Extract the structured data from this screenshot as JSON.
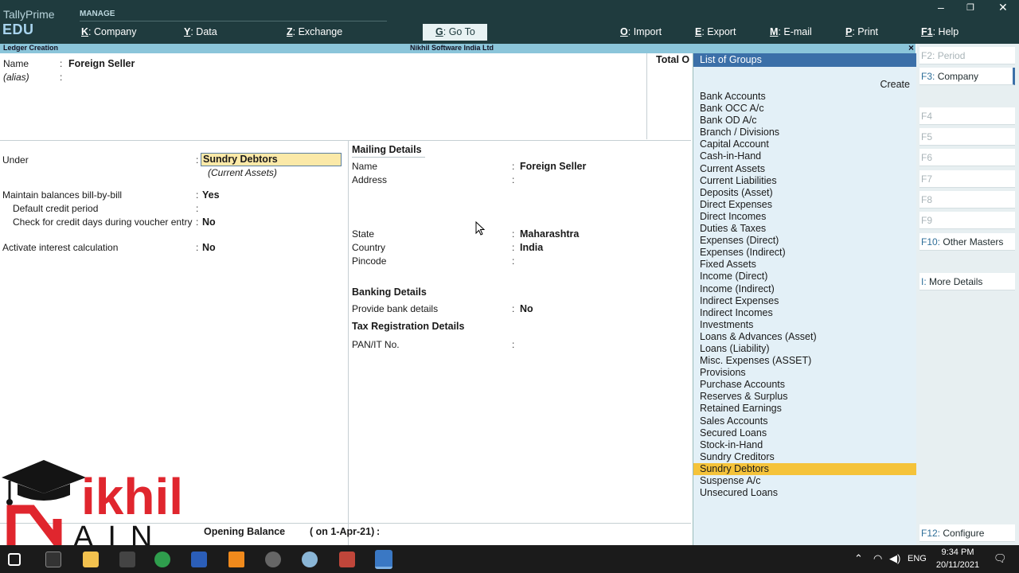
{
  "topbar": {
    "brand": "TallyPrime",
    "edition": "EDU",
    "manage_label": "MANAGE",
    "menu": [
      {
        "key": "K",
        "label": "Company"
      },
      {
        "key": "Y",
        "label": "Data"
      },
      {
        "key": "Z",
        "label": "Exchange"
      },
      {
        "key": "G",
        "label": "Go To"
      },
      {
        "key": "O",
        "label": "Import"
      },
      {
        "key": "E",
        "label": "Export"
      },
      {
        "key": "M",
        "label": "E-mail"
      },
      {
        "key": "P",
        "label": "Print"
      },
      {
        "key": "F1",
        "label": "Help"
      }
    ],
    "window_controls": {
      "minimize": "–",
      "restore": "❐",
      "close": "✕"
    }
  },
  "titlestrip": {
    "screen_title": "Ledger Creation",
    "company": "Nikhil Software India Ltd",
    "close": "×"
  },
  "header": {
    "name_label": "Name",
    "name_value": "Foreign Seller",
    "alias_label": "(alias)",
    "total_label": "Total O"
  },
  "form": {
    "under_label": "Under",
    "under_value": "Sundry Debtors",
    "under_sub": "(Current Assets)",
    "bill_label": "Maintain balances bill-by-bill",
    "bill_value": "Yes",
    "credit_period_label": "Default credit period",
    "credit_check_label": "Check for credit days during voucher entry",
    "credit_check_value": "No",
    "interest_label": "Activate interest calculation",
    "interest_value": "No",
    "opening_label": "Opening Balance",
    "opening_date": "( on 1-Apr-21)"
  },
  "mailing": {
    "heading": "Mailing Details",
    "name_label": "Name",
    "name_value": "Foreign Seller",
    "address_label": "Address",
    "state_label": "State",
    "state_value": "Maharashtra",
    "country_label": "Country",
    "country_value": "India",
    "pincode_label": "Pincode"
  },
  "banking": {
    "heading": "Banking Details",
    "bank_label": "Provide bank details",
    "bank_value": "No"
  },
  "tax": {
    "heading": "Tax Registration Details",
    "pan_label": "PAN/IT No."
  },
  "groups": {
    "title": "List of Groups",
    "create": "Create",
    "selected": "Sundry Debtors",
    "items": [
      "Bank Accounts",
      "Bank OCC A/c",
      "Bank OD A/c",
      "Branch / Divisions",
      "Capital Account",
      "Cash-in-Hand",
      "Current Assets",
      "Current Liabilities",
      "Deposits (Asset)",
      "Direct Expenses",
      "Direct Incomes",
      "Duties & Taxes",
      "Expenses (Direct)",
      "Expenses (Indirect)",
      "Fixed Assets",
      "Income (Direct)",
      "Income (Indirect)",
      "Indirect Expenses",
      "Indirect Incomes",
      "Investments",
      "Loans & Advances (Asset)",
      "Loans (Liability)",
      "Misc. Expenses (ASSET)",
      "Provisions",
      "Purchase Accounts",
      "Reserves & Surplus",
      "Retained Earnings",
      "Sales Accounts",
      "Secured Loans",
      "Stock-in-Hand",
      "Sundry Creditors",
      "Sundry Debtors",
      "Suspense A/c",
      "Unsecured Loans"
    ]
  },
  "rightbar": {
    "f2": {
      "key": "F2:",
      "label": "Period"
    },
    "f3": {
      "key": "F3:",
      "label": "Company"
    },
    "f4": "F4",
    "f5": "F5",
    "f6": "F6",
    "f7": "F7",
    "f8": "F8",
    "f9": "F9",
    "f10": {
      "key": "F10:",
      "label": "Other Masters"
    },
    "i": {
      "key": "I:",
      "label": "More Details"
    },
    "f12": {
      "key": "F12:",
      "label": "Configure"
    }
  },
  "logo": {
    "text": "ikhil",
    "lower": "AIN",
    "letter": "N"
  },
  "taskbar": {
    "language": "ENG",
    "time": "9:34 PM",
    "date": "20/11/2021"
  },
  "colors": {
    "topbar": "#1f3b3e",
    "title_strip": "#8bc5da",
    "selection": "#f5c33a",
    "input_highlight": "#fbe9a8",
    "list_header": "#3b6fa8",
    "logo_red": "#e0262e"
  }
}
